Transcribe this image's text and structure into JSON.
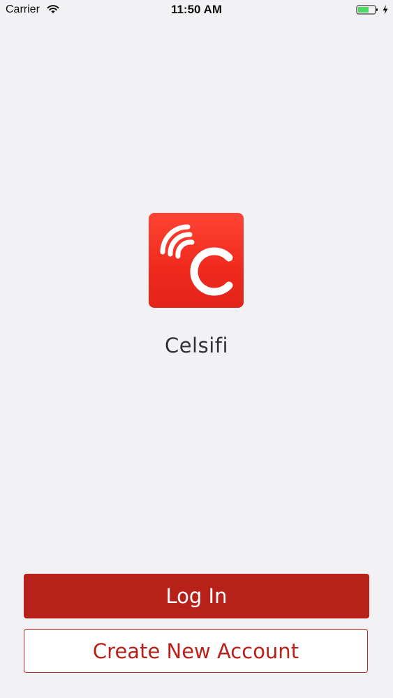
{
  "status_bar": {
    "carrier": "Carrier",
    "time": "11:50 AM",
    "wifi_icon": "wifi-icon",
    "battery_icon": "battery-icon",
    "charging_icon": "charging-bolt-icon",
    "battery_color": "#4cd964"
  },
  "app": {
    "logo_icon": "celsifi-logo-icon",
    "name": "Celsifi",
    "logo_color": "#ee2a1d"
  },
  "actions": {
    "login_label": "Log In",
    "create_account_label": "Create New Account",
    "accent_color": "#b82119"
  }
}
